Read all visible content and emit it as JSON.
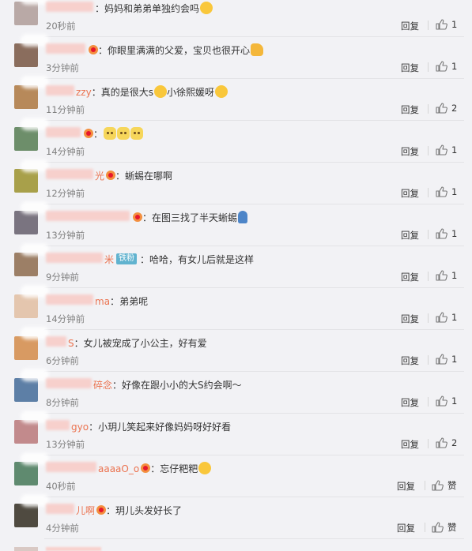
{
  "actions": {
    "reply_label": "回复"
  },
  "colors": {
    "username": "#eb7350",
    "background": "#f2f2f5",
    "blur_pink": "#f7d0cc"
  },
  "comments": [
    {
      "name_visible": "",
      "avatar_color": "#b9a9a6",
      "blur_width": 60,
      "badge": false,
      "fan_badge": "",
      "text": "妈妈和弟弟单独约会吗",
      "emojis": [
        "emoji-icon"
      ],
      "time": "20秒前",
      "likes": "1"
    },
    {
      "name_visible": "",
      "avatar_color": "#8a6d5d",
      "blur_width": 50,
      "badge": true,
      "fan_badge": "",
      "text": "你眼里满满的父爱，宝贝也很开心",
      "emojis": [
        "thumbs-up-icon"
      ],
      "time": "3分钟前",
      "likes": "1"
    },
    {
      "name_visible": "zzy",
      "avatar_color": "#b7895a",
      "blur_width": 36,
      "badge": false,
      "fan_badge": "",
      "text": "真的是很大s",
      "emojis": [
        "surprised-emoji-icon"
      ],
      "text2": " 小徐熙媛呀",
      "emojis2": [
        "surprised-emoji-icon"
      ],
      "time": "11分钟前",
      "likes": "2"
    },
    {
      "name_visible": "",
      "avatar_color": "#6d8e6a",
      "blur_width": 44,
      "badge": true,
      "fan_badge": "",
      "text": "",
      "emojis": [
        "cat-emoji-icon",
        "cat-emoji-icon",
        "cat-emoji-icon"
      ],
      "time": "14分钟前",
      "likes": "1"
    },
    {
      "name_visible": "光",
      "avatar_color": "#a8a04a",
      "blur_width": 60,
      "badge": true,
      "fan_badge": "",
      "text": "蜥蜴在哪啊",
      "emojis": [],
      "time": "12分钟前",
      "likes": "1"
    },
    {
      "name_visible": "",
      "avatar_color": "#7a7480",
      "blur_width": 106,
      "badge": true,
      "fan_badge": "",
      "text": "在图三找了半天蜥蜴",
      "emojis": [
        "person-emoji-icon"
      ],
      "time": "13分钟前",
      "likes": "1"
    },
    {
      "name_visible": "米",
      "avatar_color": "#9c7f66",
      "blur_width": 72,
      "badge": false,
      "fan_badge": "铁粉",
      "text": "哈哈，有女儿后就是这样",
      "emojis": [],
      "time": "9分钟前",
      "likes": "1"
    },
    {
      "name_visible": "ma",
      "avatar_color": "#e4c6ae",
      "blur_width": 60,
      "badge": false,
      "fan_badge": "",
      "text": "弟弟呢",
      "emojis": [],
      "time": "14分钟前",
      "likes": "1"
    },
    {
      "name_visible": "S",
      "avatar_color": "#d89a62",
      "blur_width": 26,
      "badge": false,
      "fan_badge": "",
      "text": "女儿被宠成了小公主，好有爱",
      "emojis": [],
      "time": "6分钟前",
      "likes": "1"
    },
    {
      "name_visible": "碎念",
      "avatar_color": "#5d7fa6",
      "blur_width": 58,
      "badge": false,
      "fan_badge": "",
      "text": "好像在跟小小的大S约会啊～",
      "emojis": [],
      "time": "8分钟前",
      "likes": "1"
    },
    {
      "name_visible": "gyo",
      "avatar_color": "#c28a8c",
      "blur_width": 30,
      "badge": false,
      "fan_badge": "",
      "text": "小玥儿笑起来好像妈妈呀好好看",
      "emojis": [],
      "time": "13分钟前",
      "likes": "2"
    },
    {
      "name_visible": "aaaaO_o",
      "avatar_color": "#5f8a6f",
      "blur_width": 64,
      "badge": true,
      "fan_badge": "",
      "text": "忘仔粑粑",
      "emojis": [
        "emoji-icon"
      ],
      "time": "40秒前",
      "likes": "赞"
    },
    {
      "name_visible": "儿啊",
      "avatar_color": "#4f4a40",
      "blur_width": 36,
      "badge": true,
      "fan_badge": "",
      "text": "玥儿头发好长了",
      "emojis": [],
      "time": "4分钟前",
      "likes": "赞"
    }
  ]
}
